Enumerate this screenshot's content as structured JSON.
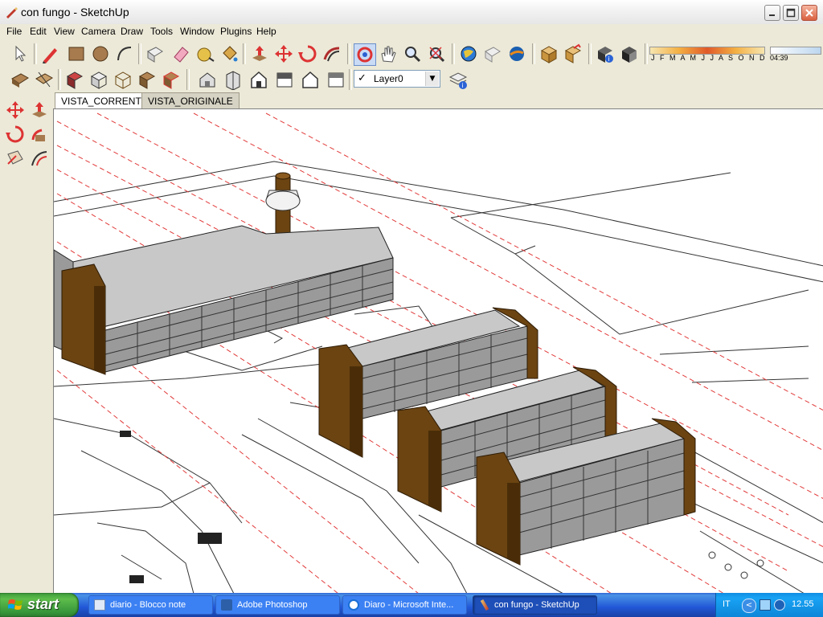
{
  "window": {
    "title": "con fungo - SketchUp"
  },
  "menu": [
    "File",
    "Edit",
    "View",
    "Camera",
    "Draw",
    "Tools",
    "Window",
    "Plugins",
    "Help"
  ],
  "toolbar": {
    "layer_select": "Layer0",
    "shadow_months": "J F M A M J J A S O N D",
    "shadow_time": "04:39"
  },
  "scene_tabs": [
    "VISTA_CORRENTE",
    "VISTA_ORIGINALE"
  ],
  "taskbar": {
    "start_label": "start",
    "tasks": [
      "diario - Blocco note",
      "Adobe Photoshop",
      "Diaro - Microsoft Inte...",
      "con fungo - SketchUp"
    ],
    "active_task": "con fungo - SketchUp",
    "language": "IT",
    "clock": "12.55"
  }
}
